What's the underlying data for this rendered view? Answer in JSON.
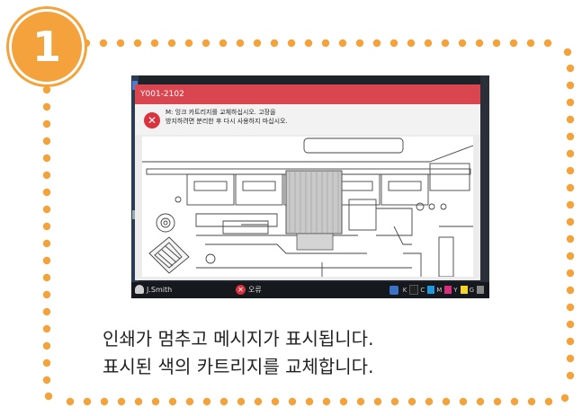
{
  "step": {
    "number": "1"
  },
  "colors": {
    "accent": "#f4a33c",
    "dialog_header": "#d94650",
    "error": "#d9333f"
  },
  "dialog": {
    "code": "Y001-2102",
    "message_line1": "M: 잉크 카트리지를 교체하십시오. 고장을",
    "message_line2": "방지하려면 분리한 후 다시 사용하지 마십시오.",
    "error_icon": "error-x-icon"
  },
  "statusbar": {
    "user": "J.Smith",
    "stop_label": "오류",
    "inks": [
      {
        "label": "K",
        "color": "#222222"
      },
      {
        "label": "C",
        "color": "#1e9be0"
      },
      {
        "label": "M",
        "color": "#d6307c"
      },
      {
        "label": "Y",
        "color": "#f2d52a"
      },
      {
        "label": "G",
        "color": "#888888"
      }
    ]
  },
  "caption": {
    "line1": "인쇄가 멈추고 메시지가 표시됩니다.",
    "line2": "표시된 색의 카트리지를 교체합니다."
  }
}
